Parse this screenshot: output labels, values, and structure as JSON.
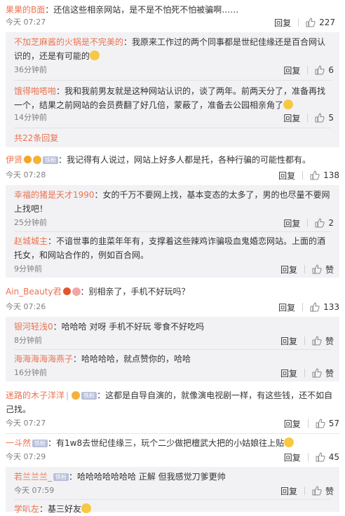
{
  "comments": {
    "c0": {
      "user": "果果的B面",
      "text": "：还信这些相亲网站，是不是不怕死不怕被骗啊……",
      "time": "今天 07:27",
      "reply": "回复",
      "likes": "227"
    },
    "r0": {
      "user": "不加芝麻酱的火锅是不完美的",
      "text": "：我原来工作过的两个同事都是世纪佳缘还是百合网认识的，还是有可能的",
      "time": "36分钟前",
      "reply": "回复",
      "likes": "6"
    },
    "r1": {
      "user": "饿得啪嗒啪",
      "text": "：我和我前男友就是这种网站认识的，谈了两年。前两天分了，准备再找一个，结果之前网站的会员费翻了好几倍，蒙蔽了，准备去公园相亲角了",
      "time": "14分钟前",
      "reply": "回复",
      "likes": "5"
    },
    "more_replies": "共22条回复",
    "c1": {
      "user": "伊贤",
      "fan": "铁粉",
      "text": "：我记得有人说过，网站上好多人都是托，各种行骗的可能性都有。",
      "time": "今天 07:28",
      "reply": "回复",
      "likes": "138"
    },
    "r2": {
      "user": "幸福的猪是天才1990",
      "text": "：女的千万不要网上找，基本变态的太多了，男的也尽量不要网上找吧！",
      "time": "25分钟前",
      "reply": "回复",
      "likes": "2"
    },
    "r3": {
      "user": "赵城城主",
      "text": "：不谙世事的韭菜年年有，支撑着这些辣鸡诈骗吸血鬼婚恋网站。上面的酒托女，和网站合作的，例如百合网。",
      "time": "9分钟前",
      "reply": "回复",
      "likes": "赞"
    },
    "c2": {
      "user": "Ain_Beauty君",
      "text": "：别相亲了，手机不好玩吗？",
      "time": "今天 07:26",
      "reply": "回复",
      "likes": "133"
    },
    "r4": {
      "user": "银河轻浅0",
      "text": "：哈哈哈 对呀 手机不好玩 零食不好吃吗",
      "time": "8分钟前",
      "reply": "回复",
      "likes": "赞"
    },
    "r5": {
      "user": "海海海海海燕子",
      "text": "：哈哈哈哈，就点赞你的，哈哈",
      "time": "16分钟前",
      "reply": "回复",
      "likes": "赞"
    },
    "c3": {
      "user": "迷路的木子洋洋",
      "fan": "铁粉",
      "text": "：这都是自导自演的，就像演电视剧一样，有这些钱，还不如自己找。",
      "time": "今天 07:27",
      "reply": "回复",
      "likes": "57"
    },
    "c4": {
      "user": "一斗然",
      "fan": "铁粉",
      "text": "：有1w8去世纪佳缘三，玩个二少做把檀武大把的小姑娘往上贴",
      "time": "今天 07:29",
      "reply": "回复",
      "likes": "45"
    },
    "r6": {
      "user": "若兰兰兰_",
      "fan": "铁粉",
      "text": "：哈哈哈哈哈哈哈 正解 但我感觉刀爹更帅",
      "time": "今天 07:59",
      "reply": "回复",
      "likes": "赞"
    },
    "r7": {
      "user": "学叭左",
      "text": "：基三好友",
      "time": "",
      "reply": "",
      "likes": ""
    }
  },
  "colors": {
    "username": "#eb7350",
    "reply_bg": "#f2f2f5",
    "text": "#333333",
    "time": "#808080"
  },
  "icons": {
    "like": "thumbs-up-icon",
    "vip": "v-badge-icon",
    "medal": "medal-icon",
    "emoji": "laugh-emoji-icon"
  }
}
